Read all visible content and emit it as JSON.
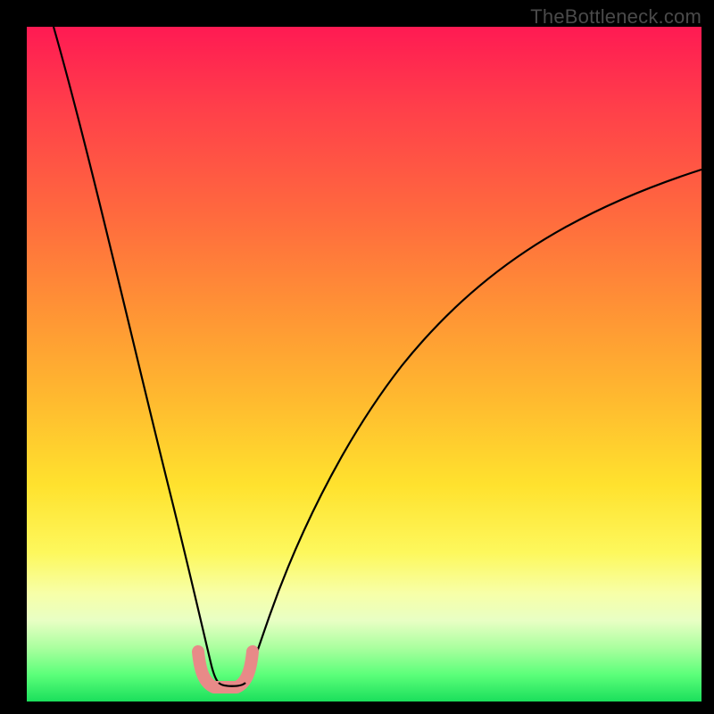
{
  "watermark": "TheBottleneck.com",
  "chart_data": {
    "type": "line",
    "title": "",
    "xlabel": "",
    "ylabel": "",
    "xlim": [
      0,
      100
    ],
    "ylim": [
      0,
      100
    ],
    "grid": false,
    "legend": false,
    "series": [
      {
        "name": "left-curve",
        "x": [
          4,
          6,
          8,
          10,
          12,
          14,
          16,
          18,
          20,
          22,
          24,
          25,
          26,
          27,
          28
        ],
        "y": [
          100,
          90,
          80,
          70,
          60,
          50,
          40,
          30,
          21,
          14,
          8,
          6,
          4.5,
          3.5,
          3
        ]
      },
      {
        "name": "right-curve",
        "x": [
          32,
          33,
          34,
          36,
          38,
          41,
          45,
          50,
          56,
          63,
          71,
          80,
          90,
          100
        ],
        "y": [
          3,
          4,
          5.5,
          9,
          14,
          22,
          31,
          40,
          48,
          56,
          63,
          69,
          74.5,
          79
        ]
      },
      {
        "name": "bottom-marker",
        "x": [
          25,
          25.5,
          26,
          27,
          28,
          29,
          30,
          31,
          31.5,
          32
        ],
        "y": [
          6,
          4,
          2.8,
          2.2,
          2.1,
          2.1,
          2.2,
          2.6,
          4,
          6
        ]
      }
    ],
    "colors": {
      "curve": "#000000",
      "marker": "#e88a88"
    }
  }
}
